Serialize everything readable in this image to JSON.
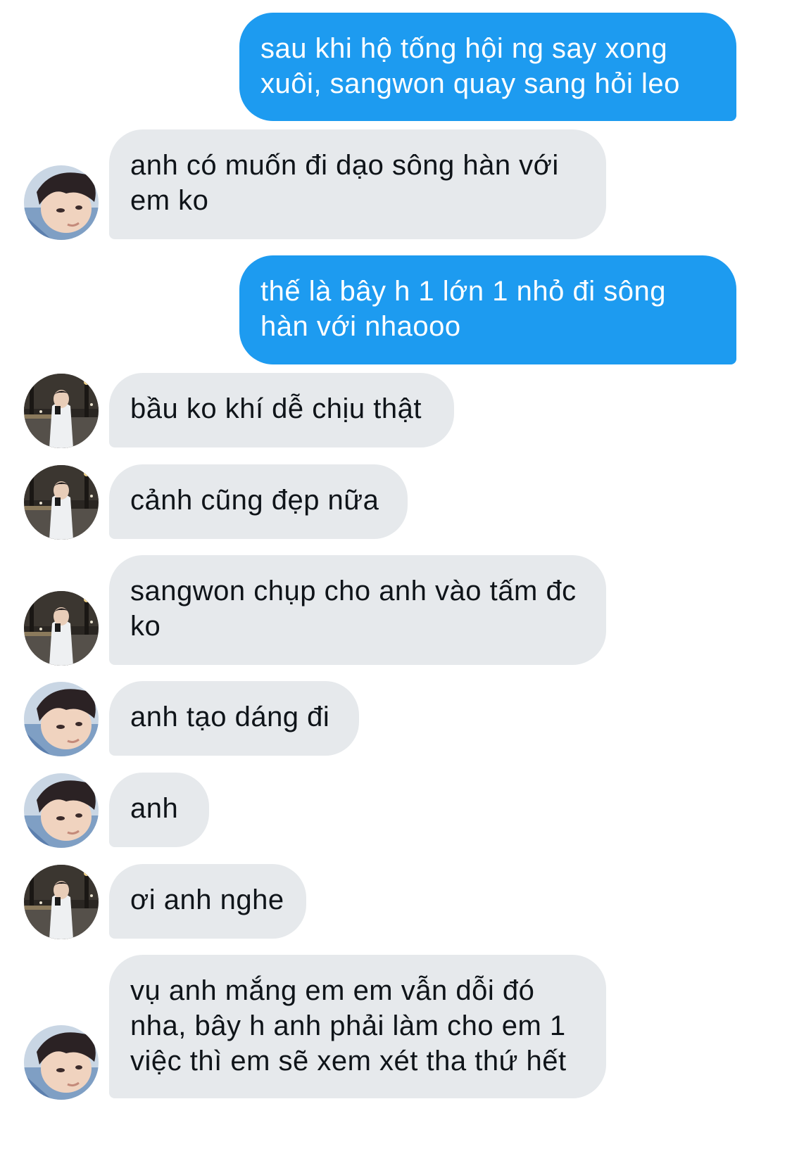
{
  "conversation": {
    "messages": [
      {
        "from": "sender",
        "text": "sau khi hộ tống hội ng say xong xuôi, sangwon quay sang hỏi leo"
      },
      {
        "from": "contact",
        "avatar": "selfie-avatar-icon",
        "text": "anh có muốn đi dạo sông hàn với em ko"
      },
      {
        "from": "sender",
        "text": "thế là bây h 1 lớn 1 nhỏ đi sông hàn với nhaooo"
      },
      {
        "from": "contact",
        "avatar": "night-street-avatar-icon",
        "text": "bầu ko khí dễ chịu thật"
      },
      {
        "from": "contact",
        "avatar": "night-street-avatar-icon",
        "text": "cảnh cũng đẹp nữa"
      },
      {
        "from": "contact",
        "avatar": "night-street-avatar-icon",
        "text": "sangwon chụp cho anh vào tấm đc ko"
      },
      {
        "from": "contact",
        "avatar": "selfie-avatar-icon",
        "text": "anh tạo dáng đi"
      },
      {
        "from": "contact",
        "avatar": "selfie-avatar-icon",
        "text": "anh"
      },
      {
        "from": "contact",
        "avatar": "night-street-avatar-icon",
        "text": "ơi anh nghe"
      },
      {
        "from": "contact",
        "avatar": "selfie-avatar-icon",
        "text": "vụ anh mắng em em vẫn dỗi đó nha, bây h anh phải làm cho em 1 việc thì em sẽ xem xét tha thứ hết"
      }
    ]
  },
  "colors": {
    "outgoing_bubble": "#1d9bf0",
    "incoming_bubble": "#e6e9ec",
    "outgoing_text": "#ffffff",
    "incoming_text": "#0f1419"
  }
}
